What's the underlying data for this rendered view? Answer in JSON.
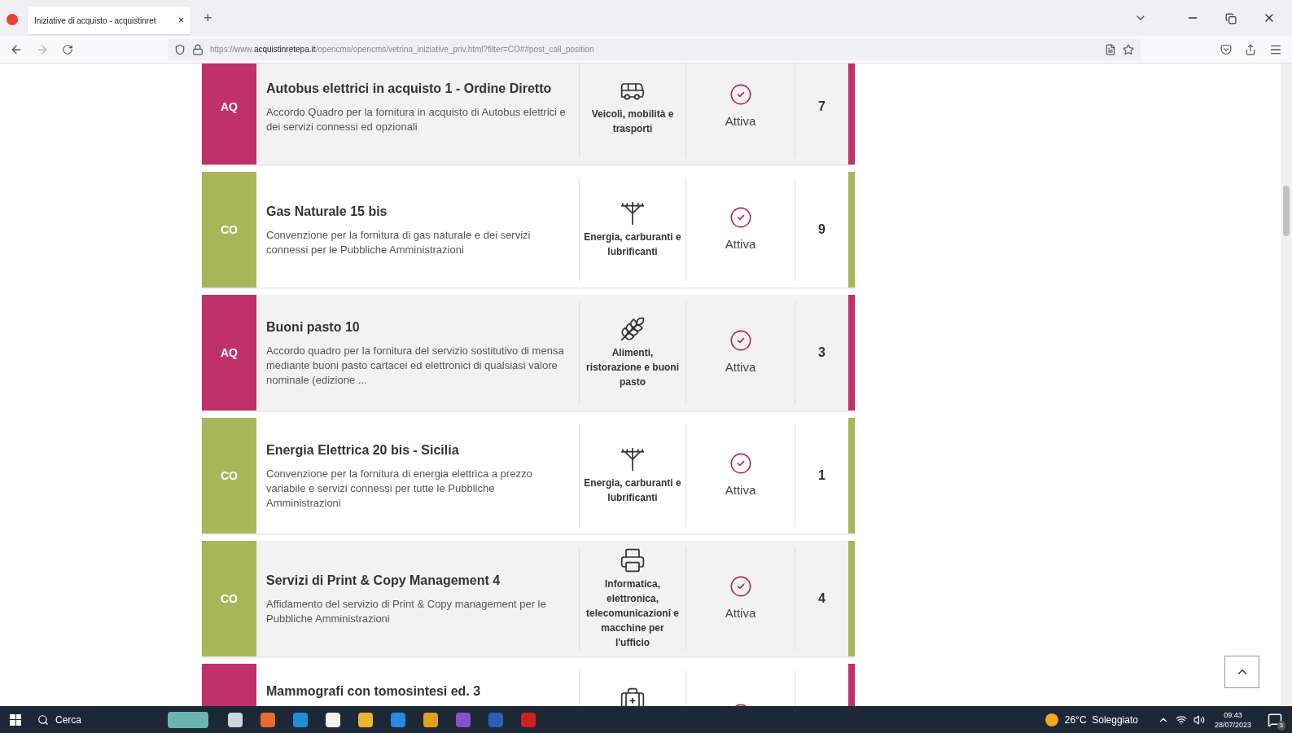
{
  "browser": {
    "tab_title": "Iniziative di acquisto - acquistinret",
    "tab_close": "×",
    "new_tab": "+",
    "url_prefix": "https://www.",
    "url_domain": "acquistinretepa.it",
    "url_path": "/opencms/opencms/vetrina_iniziative_priv.html?filter=CO##post_call_position"
  },
  "cards": [
    {
      "badge": "AQ",
      "color": "#c0306a",
      "title": "Autobus elettrici in acquisto 1 - Ordine Diretto",
      "description": "Accordo Quadro per la fornitura in acquisto di Autobus elettrici e dei servizi connessi ed opzionali",
      "kind": "bus",
      "category": "Veicoli, mobilità e trasporti",
      "status": "Attiva",
      "count": "7"
    },
    {
      "badge": "CO",
      "color": "#a8b65a",
      "title": "Gas Naturale 15 bis",
      "description": "Convenzione per la fornitura di gas naturale e dei servizi connessi per le Pubbliche Amministrazioni",
      "kind": "energy",
      "category": "Energia, carburanti e lubrificanti",
      "status": "Attiva",
      "count": "9"
    },
    {
      "badge": "AQ",
      "color": "#c0306a",
      "title": "Buoni pasto 10",
      "description": "Accordo quadro per la fornitura del servizio sostitutivo di mensa mediante buoni pasto cartacei ed elettronici di qualsiasi valore nominale (edizione ...",
      "kind": "food",
      "category": "Alimenti, ristorazione e buoni pasto",
      "status": "Attiva",
      "count": "3"
    },
    {
      "badge": "CO",
      "color": "#a8b65a",
      "title": "Energia Elettrica 20 bis - Sicilia",
      "description": "Convenzione per la fornitura di energia elettrica a prezzo variabile e servizi connessi per tutte le Pubbliche Amministrazioni",
      "kind": "energy",
      "category": "Energia, carburanti e lubrificanti",
      "status": "Attiva",
      "count": "1"
    },
    {
      "badge": "CO",
      "color": "#a8b65a",
      "title": "Servizi di Print & Copy Management 4",
      "description": "Affidamento del servizio di Print & Copy management per le Pubbliche Amministrazioni",
      "kind": "printer",
      "category": "Informatica, elettronica, telecomunicazioni e macchine per l'ufficio",
      "status": "Attiva",
      "count": "4"
    },
    {
      "color": "#c0306a",
      "title": "Mammografi con tomosintesi ed. 3",
      "kind": "medical"
    }
  ],
  "taskbar": {
    "search": "Cerca",
    "weather": "26°C  Soleggiato",
    "time": "09:43",
    "date": "28/07/2023",
    "notifications": "3"
  }
}
